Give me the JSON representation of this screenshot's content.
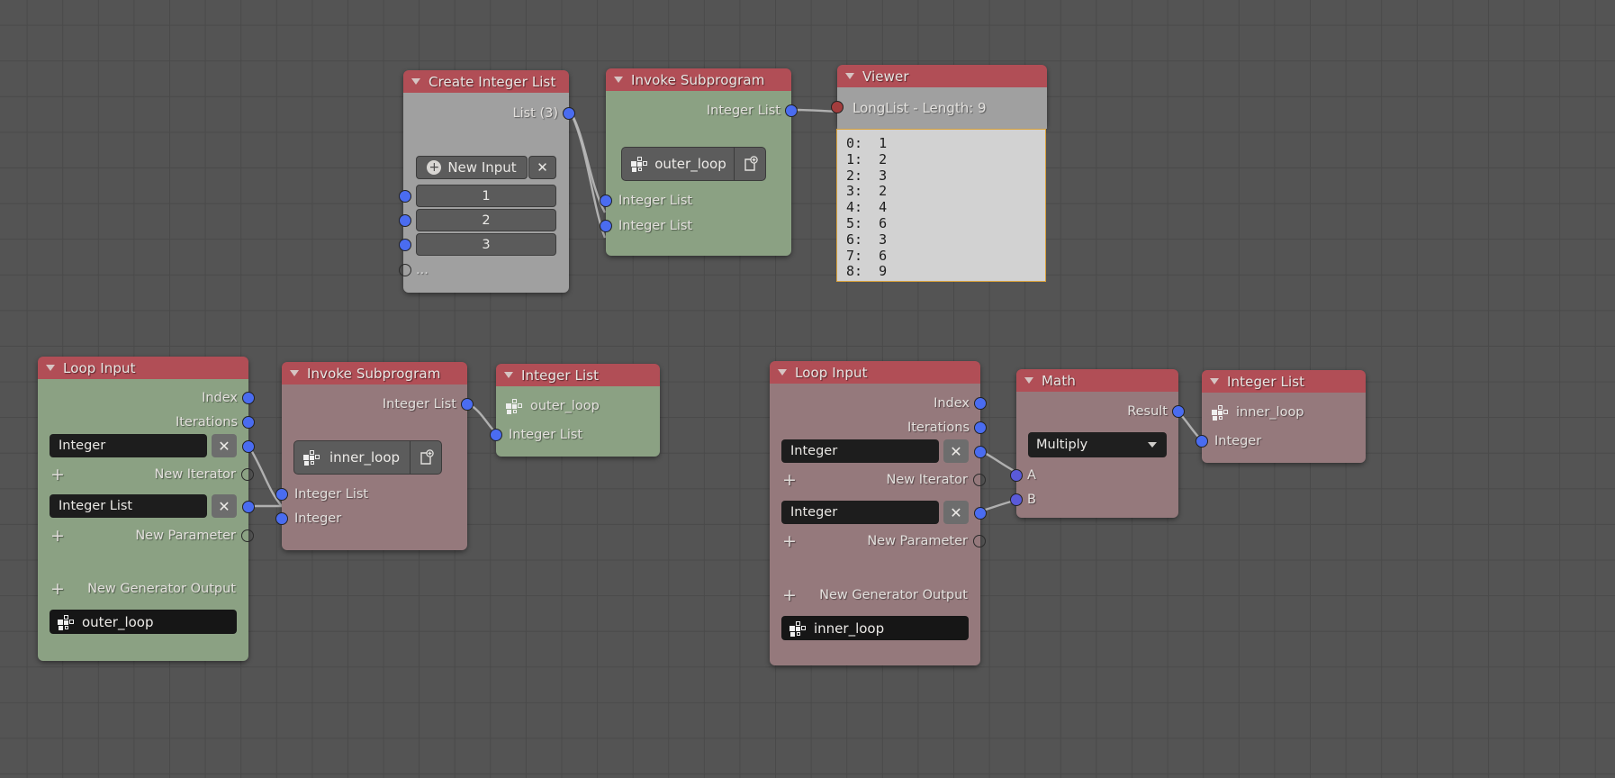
{
  "app": {
    "editor": "node-editor",
    "background_color": "#545454",
    "grid_color": "#4a4a4a",
    "header_color": "#b14e56",
    "body_green": "#8ba183",
    "body_grey": "#a0a0a0",
    "body_mauve": "#95797c",
    "socket_color": "#4a6cf0",
    "socket_red": "#a33d3d",
    "highlight_border": "#d8a13c"
  },
  "nodes": {
    "create_integer_list": {
      "title": "Create Integer List",
      "output_label": "List (3)",
      "new_input_button": "New Input",
      "remove_button": "✕",
      "values": [
        "1",
        "2",
        "3"
      ],
      "ellipsis": "..."
    },
    "invoke_subprogram_outer": {
      "title": "Invoke Subprogram",
      "output_label": "Integer List",
      "subprogram_name": "outer_loop",
      "inputs": [
        "Integer List",
        "Integer List"
      ]
    },
    "viewer": {
      "title": "Viewer",
      "status": "LongList - Length: 9",
      "entries": [
        "0:  1",
        "1:  2",
        "2:  3",
        "3:  2",
        "4:  4",
        "5:  6",
        "6:  3",
        "7:  6",
        "8:  9"
      ]
    },
    "loop_input_outer": {
      "title": "Loop Input",
      "index_label": "Index",
      "iterations_label": "Iterations",
      "iterator_type": "Integer",
      "new_iterator_label": "New Iterator",
      "parameter_type": "Integer List",
      "new_parameter_label": "New Parameter",
      "new_generator_output_label": "New Generator Output",
      "subprogram_name": "outer_loop",
      "remove_button": "✕",
      "add_button": "+"
    },
    "invoke_subprogram_inner": {
      "title": "Invoke Subprogram",
      "output_label": "Integer List",
      "subprogram_name": "inner_loop",
      "inputs": [
        "Integer List",
        "Integer"
      ]
    },
    "integer_list_outer": {
      "title": "Integer List",
      "subprogram_name": "outer_loop",
      "socket_label": "Integer List"
    },
    "loop_input_inner": {
      "title": "Loop Input",
      "index_label": "Index",
      "iterations_label": "Iterations",
      "iterator_type": "Integer",
      "new_iterator_label": "New Iterator",
      "parameter_type": "Integer",
      "new_parameter_label": "New Parameter",
      "new_generator_output_label": "New Generator Output",
      "subprogram_name": "inner_loop",
      "remove_button": "✕",
      "add_button": "+"
    },
    "math": {
      "title": "Math",
      "result_label": "Result",
      "operation": "Multiply",
      "input_a": "A",
      "input_b": "B"
    },
    "integer_list_inner": {
      "title": "Integer List",
      "subprogram_name": "inner_loop",
      "socket_label": "Integer"
    }
  }
}
